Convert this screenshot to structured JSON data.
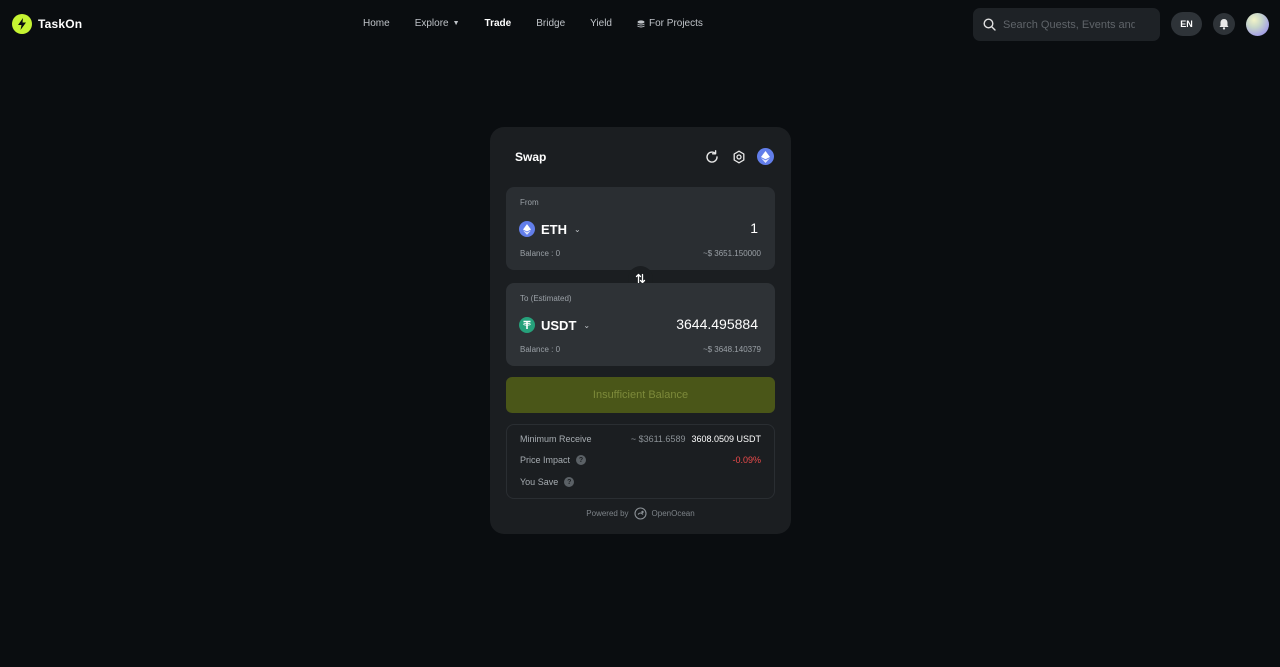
{
  "header": {
    "brand": "TaskOn",
    "nav": [
      {
        "label": "Home"
      },
      {
        "label": "Explore"
      },
      {
        "label": "Trade"
      },
      {
        "label": "Bridge"
      },
      {
        "label": "Yield"
      },
      {
        "label": "For Projects"
      }
    ],
    "search_placeholder": "Search Quests, Events and Comm",
    "lang": "EN"
  },
  "swap": {
    "title": "Swap",
    "from": {
      "label": "From",
      "token": "ETH",
      "amount": "1",
      "balance": "Balance : 0",
      "usd": "~$ 3651.150000"
    },
    "to": {
      "label": "To (Estimated)",
      "token": "USDT",
      "amount": "3644.495884",
      "balance": "Balance : 0",
      "usd": "~$ 3648.140379"
    },
    "submit_label": "Insufficient Balance",
    "details": {
      "min_receive_label": "Minimum Receive",
      "min_receive_usd": "~ $3611.6589",
      "min_receive_value": "3608.0509 USDT",
      "price_impact_label": "Price Impact",
      "price_impact_value": "-0.09%",
      "you_save_label": "You Save"
    },
    "powered_by": "Powered by",
    "provider": "OpenOcean"
  },
  "colors": {
    "background": "#0a0d10",
    "card": "#1b1e21",
    "accent": "#c6f432",
    "negative": "#ec4b4b"
  }
}
